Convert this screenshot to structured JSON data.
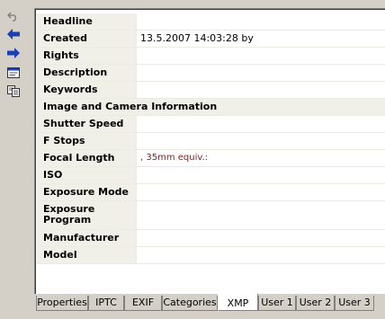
{
  "toolbar": {
    "items": [
      {
        "icon": "undo-icon"
      },
      {
        "icon": "arrow-left-icon"
      },
      {
        "icon": "arrow-right-icon"
      },
      {
        "icon": "window-icon"
      },
      {
        "icon": "copy-icon"
      }
    ]
  },
  "fields": [
    {
      "label": "Headline",
      "value": ""
    },
    {
      "label": "Created",
      "value": "13.5.2007 14:03:28 by"
    },
    {
      "label": "Rights",
      "value": ""
    },
    {
      "label": "Description",
      "value": ""
    },
    {
      "label": "Keywords",
      "value": ""
    },
    {
      "label": "Image and Camera Information",
      "value": "",
      "section": true
    },
    {
      "label": "Shutter Speed",
      "value": ""
    },
    {
      "label": "F Stops",
      "value": ""
    },
    {
      "label": "Focal Length",
      "value": ", 35mm equiv.:",
      "accent": true
    },
    {
      "label": "ISO",
      "value": ""
    },
    {
      "label": "Exposure Mode",
      "value": ""
    },
    {
      "label": "Exposure Program",
      "value": "",
      "tall": true
    },
    {
      "label": "Manufacturer",
      "value": ""
    },
    {
      "label": "Model",
      "value": ""
    }
  ],
  "tabs": [
    {
      "label": "Properties",
      "active": false
    },
    {
      "label": "IPTC",
      "active": false
    },
    {
      "label": "EXIF",
      "active": false
    },
    {
      "label": "Categories",
      "active": false
    },
    {
      "label": "XMP",
      "active": true
    },
    {
      "label": "User 1",
      "active": false
    },
    {
      "label": "User 2",
      "active": false
    },
    {
      "label": "User 3",
      "active": false
    }
  ],
  "colors": {
    "label_bg": "#f0f0e8",
    "accent_value": "#8b1a1a",
    "window_bg": "#d4d0c8"
  }
}
